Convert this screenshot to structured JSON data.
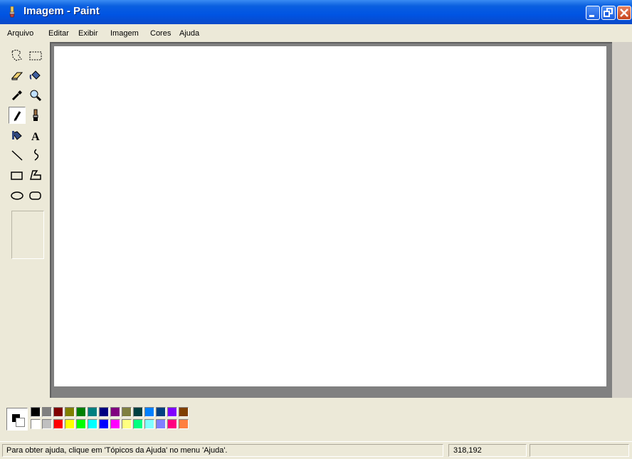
{
  "window": {
    "title": "Imagem - Paint"
  },
  "titlebar_buttons": {
    "minimize_icon": "minimize-icon",
    "maximize_icon": "maximize-icon",
    "close_icon": "close-icon"
  },
  "menu": [
    "Arquivo",
    "Editar",
    "Exibir",
    "Imagem",
    "Cores",
    "Ajuda"
  ],
  "tools": [
    {
      "name": "free-form-select",
      "icon": "free-form-select-icon"
    },
    {
      "name": "select",
      "icon": "rect-select-icon"
    },
    {
      "name": "eraser",
      "icon": "eraser-icon"
    },
    {
      "name": "fill",
      "icon": "fill-bucket-icon"
    },
    {
      "name": "pick-color",
      "icon": "eyedropper-icon"
    },
    {
      "name": "magnifier",
      "icon": "magnifier-icon"
    },
    {
      "name": "pencil",
      "icon": "pencil-icon",
      "selected": true
    },
    {
      "name": "brush",
      "icon": "brush-icon"
    },
    {
      "name": "airbrush",
      "icon": "airbrush-icon"
    },
    {
      "name": "text",
      "icon": "text-icon"
    },
    {
      "name": "line",
      "icon": "line-icon"
    },
    {
      "name": "curve",
      "icon": "curve-icon"
    },
    {
      "name": "rectangle",
      "icon": "rectangle-icon"
    },
    {
      "name": "polygon",
      "icon": "polygon-icon"
    },
    {
      "name": "ellipse",
      "icon": "ellipse-icon"
    },
    {
      "name": "rounded-rectangle",
      "icon": "rounded-rectangle-icon"
    }
  ],
  "palette": {
    "foreground": "#000000",
    "background": "#ffffff",
    "top_row": [
      "#000000",
      "#808080",
      "#800000",
      "#808000",
      "#008000",
      "#008080",
      "#000080",
      "#800080",
      "#808040",
      "#004040",
      "#0080ff",
      "#004080",
      "#8000ff",
      "#804000"
    ],
    "bottom_row": [
      "#ffffff",
      "#c0c0c0",
      "#ff0000",
      "#ffff00",
      "#00ff00",
      "#00ffff",
      "#0000ff",
      "#ff00ff",
      "#ffff80",
      "#00ff80",
      "#80ffff",
      "#8080ff",
      "#ff0080",
      "#ff8040"
    ]
  },
  "status": {
    "help_text": "Para obter ajuda, clique em 'Tópicos da Ajuda' no menu 'Ajuda'.",
    "coordinates": "318,192"
  },
  "colors": {
    "titlebar": "#0054e3",
    "chrome": "#ece9d8",
    "workspace": "#808080",
    "canvas": "#ffffff"
  }
}
